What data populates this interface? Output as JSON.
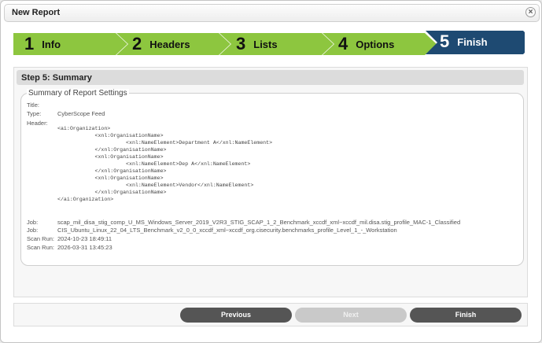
{
  "window": {
    "title": "New Report",
    "close_icon": "close-icon"
  },
  "steps": [
    {
      "num": "1",
      "label": "Info",
      "color": "#8dc63f"
    },
    {
      "num": "2",
      "label": "Headers",
      "color": "#8dc63f"
    },
    {
      "num": "3",
      "label": "Lists",
      "color": "#8dc63f"
    },
    {
      "num": "4",
      "label": "Options",
      "color": "#8dc63f"
    },
    {
      "num": "5",
      "label": "Finish",
      "color": "#1e4a72",
      "active": true
    }
  ],
  "panel": {
    "title": "Step 5: Summary"
  },
  "summary": {
    "legend": "Summary of Report Settings",
    "title_label": "Title:",
    "title_value": "",
    "type_label": "Type:",
    "type_value": "CyberScope Feed",
    "header_label": "Header:",
    "header_xml": "<ai:Organization>\n            <xnl:OrganisationName>\n                      <xnl:NameElement>Department A</xnl:NameElement>\n            </xnl:OrganisationName>\n            <xnl:OrganisationName>\n                      <xnl:NameElement>Dep A</xnl:NameElement>\n            </xnl:OrganisationName>\n            <xnl:OrganisationName>\n                      <xnl:NameElement>Vendor</xnl:NameElement>\n            </xnl:OrganisationName>\n</ai:Organization>",
    "jobs": [
      {
        "label": "Job:",
        "value": "scap_mil_disa_stig_comp_U_MS_Windows_Server_2019_V2R3_STIG_SCAP_1_2_Benchmark_xccdf_xml~xccdf_mil.disa.stig_profile_MAC-1_Classified"
      },
      {
        "label": "Job:",
        "value": "CIS_Ubuntu_Linux_22_04_LTS_Benchmark_v2_0_0_xccdf_xml~xccdf_org.cisecurity.benchmarks_profile_Level_1_-_Workstation"
      }
    ],
    "scan_runs": [
      {
        "label": "Scan Run:",
        "value": "2024-10-23 18:49:11"
      },
      {
        "label": "Scan Run:",
        "value": "2026-03-31 13:45:23"
      }
    ]
  },
  "buttons": {
    "previous": "Previous",
    "next": "Next",
    "finish": "Finish"
  }
}
